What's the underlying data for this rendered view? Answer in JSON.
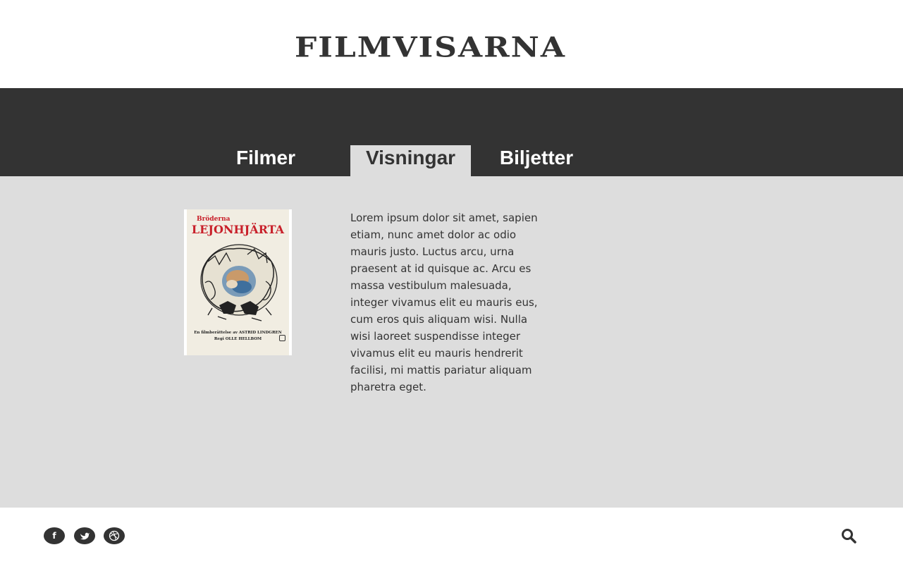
{
  "header": {
    "logo": "FILMVISARNA"
  },
  "nav": {
    "items": [
      {
        "label": "Filmer",
        "active": false
      },
      {
        "label": "Visningar",
        "active": true
      },
      {
        "label": "Biljetter",
        "active": false
      }
    ]
  },
  "poster": {
    "top_text": "Bröderna",
    "title": "LEJONHJÄRTA",
    "credit_line1": "En filmberättelse av ASTRID LINDGREN",
    "credit_line2": "Regi OLLE HELLBOM"
  },
  "main": {
    "description": "Lorem ipsum dolor sit amet, sapien etiam, nunc amet dolor ac odio mauris justo. Luctus arcu, urna praesent at id quisque ac. Arcu es massa vestibulum malesuada, integer vivamus elit eu mauris eus, cum eros quis aliquam wisi. Nulla wisi laoreet suspendisse integer vivamus elit eu mauris hendrerit facilisi, mi mattis pariatur aliquam pharetra eget."
  },
  "footer": {
    "social": [
      {
        "icon": "facebook-icon",
        "glyph": "f"
      },
      {
        "icon": "twitter-icon"
      },
      {
        "icon": "dribbble-icon"
      }
    ],
    "search_icon": "search-icon"
  },
  "colors": {
    "dark": "#333333",
    "content_bg": "#dddddd",
    "active_tab_bg": "#dddddd",
    "poster_red": "#c8202a"
  }
}
